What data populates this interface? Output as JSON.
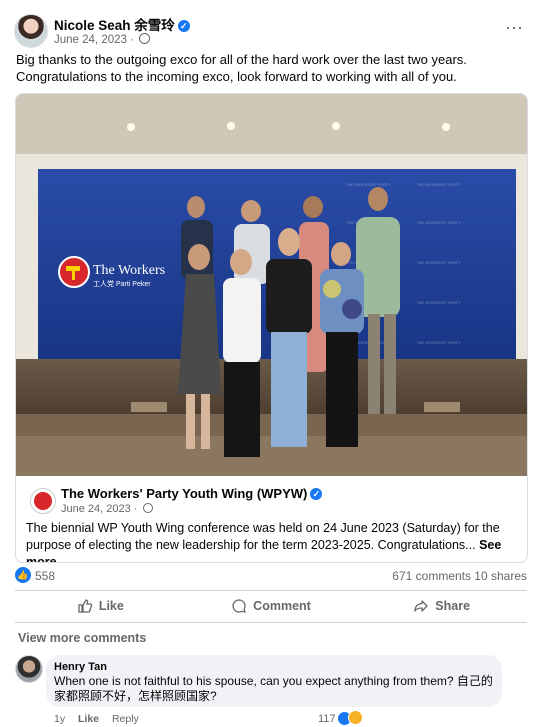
{
  "post": {
    "author": "Nicole Seah 余雪玲",
    "date": "June 24, 2023 ·",
    "text": "Big thanks to the outgoing exco for all of the hard work over the last two years. Congratulations to the incoming exco, look forward to working with all of you.",
    "more_icon": "⋯"
  },
  "photo": {
    "backdrop_text": "The Workers",
    "backdrop_sub": "工人党   Parti Peker",
    "colors": {
      "backdrop": "#1f3f99",
      "brand_red": "#d7262c"
    }
  },
  "shared": {
    "page_name": "The Workers' Party Youth Wing (WPYW)",
    "date": "June 24, 2023 ·",
    "description": "The biennial WP Youth Wing conference was held on 24 June 2023 (Saturday) for the purpose of electing the new leadership for the term 2023-2025. Congratulations...",
    "see_more": "See more"
  },
  "stats": {
    "reactions": "558",
    "comments": "671 comments",
    "shares": "10 shares"
  },
  "actions": {
    "like": "Like",
    "comment": "Comment",
    "share": "Share"
  },
  "comments_section": {
    "view_more": "View more comments",
    "comment": {
      "author": "Henry Tan",
      "text": "When one is not faithful to his spouse, can you expect anything from them? 自己的家都照顾不好，怎样照顾国家?",
      "age": "1y",
      "like": "Like",
      "reply": "Reply",
      "reaction_count": "117"
    }
  },
  "colors": {
    "accent": "#1877f2",
    "muted": "#65676b"
  }
}
